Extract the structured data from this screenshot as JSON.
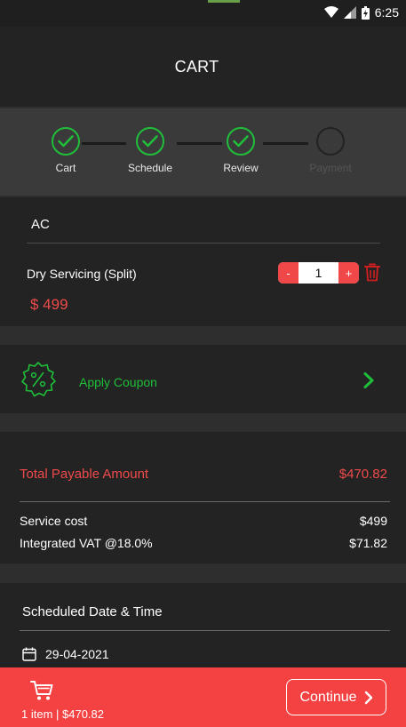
{
  "status_bar": {
    "time": "6:25"
  },
  "header": {
    "title": "CART"
  },
  "stepper": {
    "steps": [
      {
        "label": "Cart",
        "done": true
      },
      {
        "label": "Schedule",
        "done": true
      },
      {
        "label": "Review",
        "done": true
      },
      {
        "label": "Payment",
        "done": false
      }
    ]
  },
  "cart": {
    "category": "AC",
    "item_name": "Dry Servicing (Split)",
    "price": "$ 499",
    "qty_minus": "-",
    "quantity": "1",
    "qty_plus": "+"
  },
  "coupon": {
    "label": "Apply Coupon"
  },
  "totals": {
    "payable_label": "Total Payable Amount",
    "payable_value": "$470.82",
    "rows": [
      {
        "label": "Service cost",
        "value": "$499"
      },
      {
        "label": "Integrated VAT @18.0%",
        "value": "$71.82"
      }
    ]
  },
  "schedule": {
    "title": "Scheduled Date & Time",
    "date": "29-04-2021"
  },
  "bottom_bar": {
    "summary": "1 item | $470.82",
    "continue_label": "Continue"
  },
  "colors": {
    "accent_red": "#f44242",
    "success_green": "#1fbf3a",
    "background": "#2e2e2e",
    "card": "#232323"
  }
}
